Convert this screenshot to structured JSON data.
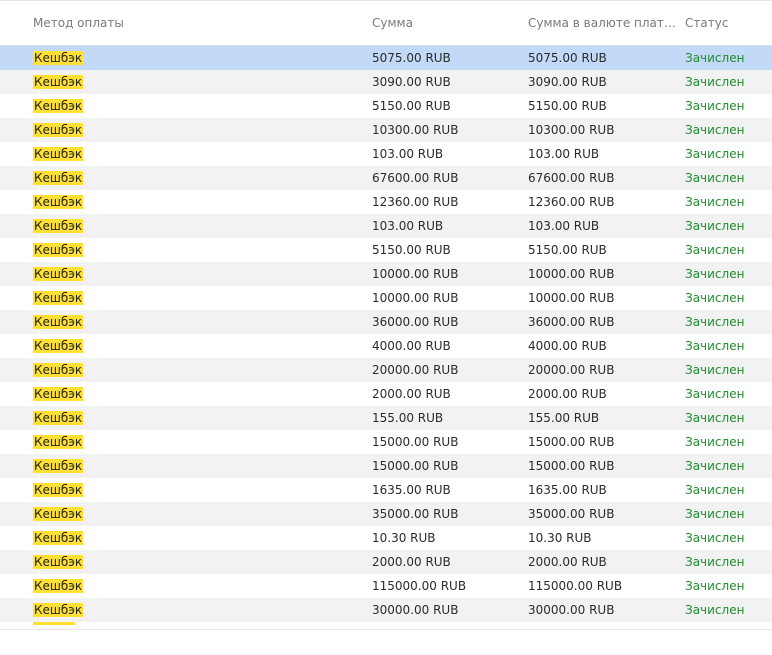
{
  "table": {
    "headers": {
      "method": "Метод оплаты",
      "sum": "Сумма",
      "currency_sum": "Сумма в валюте плат…",
      "status": "Статус"
    },
    "rows": [
      {
        "method": "Кешбэк",
        "sum": "5075.00 RUB",
        "currency_sum": "5075.00 RUB",
        "status": "Зачислен",
        "selected": true
      },
      {
        "method": "Кешбэк",
        "sum": "3090.00 RUB",
        "currency_sum": "3090.00 RUB",
        "status": "Зачислен"
      },
      {
        "method": "Кешбэк",
        "sum": "5150.00 RUB",
        "currency_sum": "5150.00 RUB",
        "status": "Зачислен"
      },
      {
        "method": "Кешбэк",
        "sum": "10300.00 RUB",
        "currency_sum": "10300.00 RUB",
        "status": "Зачислен"
      },
      {
        "method": "Кешбэк",
        "sum": "103.00 RUB",
        "currency_sum": "103.00 RUB",
        "status": "Зачислен"
      },
      {
        "method": "Кешбэк",
        "sum": "67600.00 RUB",
        "currency_sum": "67600.00 RUB",
        "status": "Зачислен"
      },
      {
        "method": "Кешбэк",
        "sum": "12360.00 RUB",
        "currency_sum": "12360.00 RUB",
        "status": "Зачислен"
      },
      {
        "method": "Кешбэк",
        "sum": "103.00 RUB",
        "currency_sum": "103.00 RUB",
        "status": "Зачислен"
      },
      {
        "method": "Кешбэк",
        "sum": "5150.00 RUB",
        "currency_sum": "5150.00 RUB",
        "status": "Зачислен"
      },
      {
        "method": "Кешбэк",
        "sum": "10000.00 RUB",
        "currency_sum": "10000.00 RUB",
        "status": "Зачислен"
      },
      {
        "method": "Кешбэк",
        "sum": "10000.00 RUB",
        "currency_sum": "10000.00 RUB",
        "status": "Зачислен"
      },
      {
        "method": "Кешбэк",
        "sum": "36000.00 RUB",
        "currency_sum": "36000.00 RUB",
        "status": "Зачислен"
      },
      {
        "method": "Кешбэк",
        "sum": "4000.00 RUB",
        "currency_sum": "4000.00 RUB",
        "status": "Зачислен"
      },
      {
        "method": "Кешбэк",
        "sum": "20000.00 RUB",
        "currency_sum": "20000.00 RUB",
        "status": "Зачислен"
      },
      {
        "method": "Кешбэк",
        "sum": "2000.00 RUB",
        "currency_sum": "2000.00 RUB",
        "status": "Зачислен"
      },
      {
        "method": "Кешбэк",
        "sum": "155.00 RUB",
        "currency_sum": "155.00 RUB",
        "status": "Зачислен"
      },
      {
        "method": "Кешбэк",
        "sum": "15000.00 RUB",
        "currency_sum": "15000.00 RUB",
        "status": "Зачислен"
      },
      {
        "method": "Кешбэк",
        "sum": "15000.00 RUB",
        "currency_sum": "15000.00 RUB",
        "status": "Зачислен"
      },
      {
        "method": "Кешбэк",
        "sum": "1635.00 RUB",
        "currency_sum": "1635.00 RUB",
        "status": "Зачислен"
      },
      {
        "method": "Кешбэк",
        "sum": "35000.00 RUB",
        "currency_sum": "35000.00 RUB",
        "status": "Зачислен"
      },
      {
        "method": "Кешбэк",
        "sum": "10.30 RUB",
        "currency_sum": "10.30 RUB",
        "status": "Зачислен"
      },
      {
        "method": "Кешбэк",
        "sum": "2000.00 RUB",
        "currency_sum": "2000.00 RUB",
        "status": "Зачислен"
      },
      {
        "method": "Кешбэк",
        "sum": "115000.00 RUB",
        "currency_sum": "115000.00 RUB",
        "status": "Зачислен"
      },
      {
        "method": "Кешбэк",
        "sum": "30000.00 RUB",
        "currency_sum": "30000.00 RUB",
        "status": "Зачислен"
      }
    ]
  },
  "colors": {
    "highlight": "#ffe033",
    "selected_row": "#c2d9f7",
    "status_green": "#218c2e",
    "zebra": "#f2f2f2"
  }
}
